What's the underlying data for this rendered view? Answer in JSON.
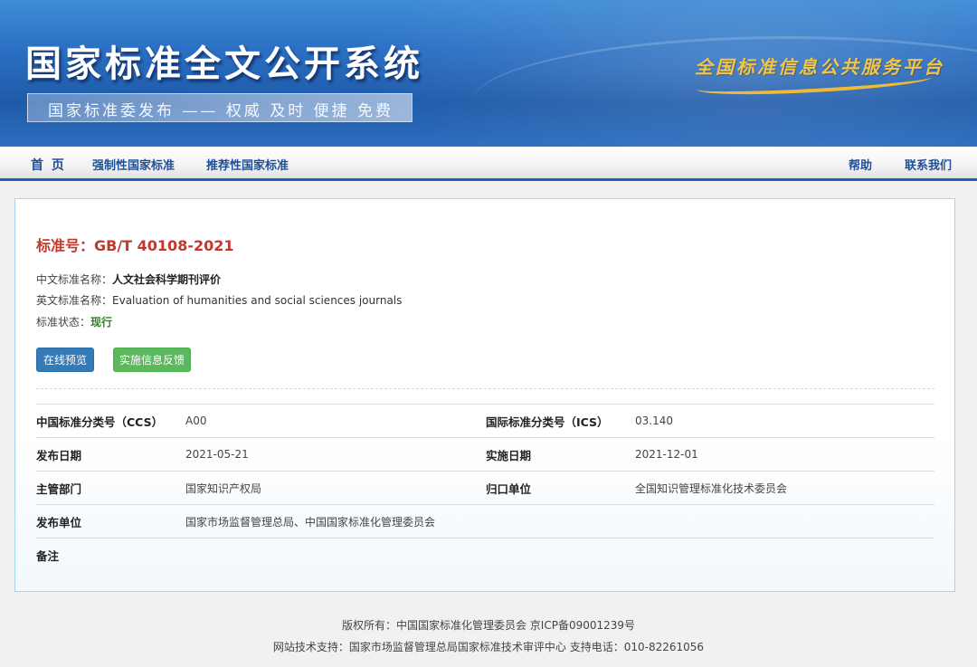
{
  "banner": {
    "site_title": "国家标准全文公开系统",
    "slogan": "国家标准委发布 —— 权威 及时 便捷 免费",
    "platform": "全国标准信息公共服务平台"
  },
  "nav": {
    "home": "首 页",
    "mandatory": "强制性国家标准",
    "recommended": "推荐性国家标准",
    "help": "帮助",
    "contact": "联系我们"
  },
  "standard": {
    "number": "标准号：GB/T 40108-2021",
    "cn_name_label": "中文标准名称：",
    "cn_name": "人文社会科学期刊评价",
    "en_name_label": "英文标准名称：",
    "en_name": "Evaluation of humanities and social sciences journals",
    "status_label": "标准状态：",
    "status": "现行"
  },
  "buttons": {
    "preview": "在线预览",
    "feedback": "实施信息反馈"
  },
  "details": {
    "ccs_label": "中国标准分类号（CCS）",
    "ccs": "A00",
    "ics_label": "国际标准分类号（ICS）",
    "ics": "03.140",
    "publish_date_label": "发布日期",
    "publish_date": "2021-05-21",
    "implement_date_label": "实施日期",
    "implement_date": "2021-12-01",
    "authority_label": "主管部门",
    "authority": "国家知识产权局",
    "committee_label": "归口单位",
    "committee": "全国知识管理标准化技术委员会",
    "issuer_label": "发布单位",
    "issuer": "国家市场监督管理总局、中国国家标准化管理委员会",
    "remark_label": "备注",
    "remark": ""
  },
  "footer": {
    "copyright": "版权所有：中国国家标准化管理委员会 京ICP备09001239号",
    "support": "网站技术支持：国家市场监督管理总局国家标准技术审评中心 支持电话：010-82261056"
  },
  "colors": {
    "banner_blue": "#2a6fc2",
    "nav_text": "#1f4f95",
    "standard_number": "#c0392b",
    "status_green": "#3a7d2c",
    "preview_button": "#337ab7",
    "feedback_button": "#5cb85c"
  }
}
